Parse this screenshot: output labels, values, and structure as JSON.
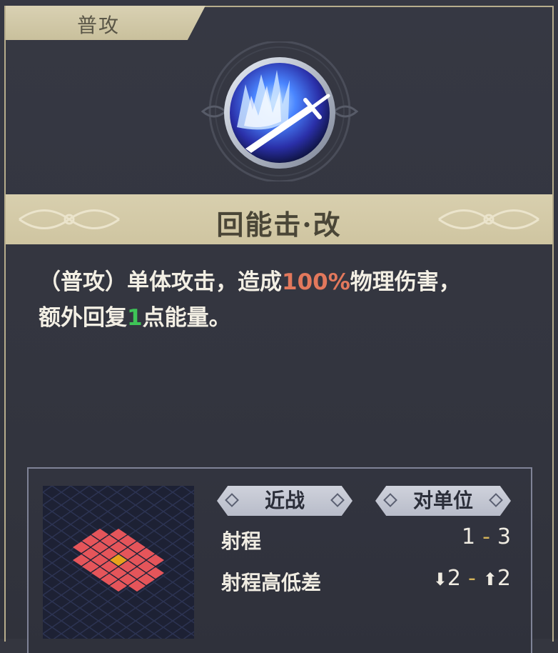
{
  "tab": {
    "label": "普攻"
  },
  "skill": {
    "icon": "sword-slash-icon",
    "name": "回能击·改",
    "description": {
      "line1_prefix": "（普攻）单体攻击，造成",
      "line1_value": "100%",
      "line1_suffix": "物理伤害，",
      "line2_prefix": "额外回复",
      "line2_value": "1",
      "line2_suffix": "点能量。"
    }
  },
  "tags": {
    "range_type": "近战",
    "target_type": "对单位"
  },
  "stats": {
    "range_label": "射程",
    "range_min": "1",
    "range_sep": "-",
    "range_max": "3",
    "height_label": "射程高低差",
    "height_down": "2",
    "height_sep": "-",
    "height_up": "2"
  },
  "colors": {
    "accent_red": "#e2785c",
    "accent_green": "#3ec457",
    "range_tile": "#e5555a",
    "center_tile": "#e8a21c"
  }
}
